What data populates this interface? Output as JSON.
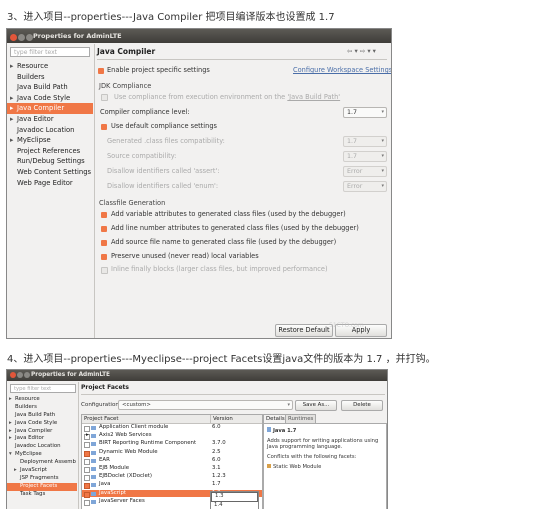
{
  "step3": {
    "text": "3、进入项目--properties---Java Compiler 把项目编译版本也设置成 1.7"
  },
  "step4": {
    "text": "4、进入项目--properties---Myeclipse---project Facets设置java文件的版本为 1.7 ，并打钩。"
  },
  "dialog1": {
    "title": "Properties for AdminLTE",
    "filter_placeholder": "type filter text",
    "tree": [
      {
        "label": "Resource",
        "arrow": "▸",
        "selected": false
      },
      {
        "label": "Builders",
        "arrow": "",
        "selected": false
      },
      {
        "label": "Java Build Path",
        "arrow": "",
        "selected": false
      },
      {
        "label": "Java Code Style",
        "arrow": "▸",
        "selected": false
      },
      {
        "label": "Java Compiler",
        "arrow": "▸",
        "selected": true
      },
      {
        "label": "Java Editor",
        "arrow": "▸",
        "selected": false
      },
      {
        "label": "Javadoc Location",
        "arrow": "",
        "selected": false
      },
      {
        "label": "MyEclipse",
        "arrow": "▸",
        "selected": false
      },
      {
        "label": "Project References",
        "arrow": "",
        "selected": false
      },
      {
        "label": "Run/Debug Settings",
        "arrow": "",
        "selected": false
      },
      {
        "label": "Web Content Settings",
        "arrow": "",
        "selected": false
      },
      {
        "label": "Web Page Editor",
        "arrow": "",
        "selected": false
      }
    ],
    "panel_title": "Java Compiler",
    "nav": "⇦ ▾ ⇨ ▾ ▾",
    "enable_specific": "Enable project specific settings",
    "configure_workspace": "Configure Workspace Settings...",
    "jdk_section": "JDK Compliance",
    "use_compliance_prefix": "Use compliance from execution environment on the ",
    "use_compliance_link": "'Java Build Path'",
    "compliance_level_label": "Compiler compliance level:",
    "compliance_level_value": "1.7",
    "use_default": "Use default compliance settings",
    "generated_label": "Generated .class files compatibility:",
    "generated_value": "1.7",
    "source_label": "Source compatibility:",
    "source_value": "1.7",
    "assert_label": "Disallow identifiers called 'assert':",
    "assert_value": "Error",
    "enum_label": "Disallow identifiers called 'enum':",
    "enum_value": "Error",
    "classfile_section": "Classfile Generation",
    "opt_variable": "Add variable attributes to generated class files (used by the debugger)",
    "opt_line": "Add line number attributes to generated class files (used by the debugger)",
    "opt_source": "Add source file name to generated class file (used by the debugger)",
    "opt_preserve": "Preserve unused (never read) local variables",
    "opt_inline": "Inline finally blocks (larger class files, but improved performance)",
    "restore_default": "Restore Default",
    "apply": "Apply",
    "watermark": "51CTO.com"
  },
  "dialog2": {
    "title": "Properties for AdminLTE",
    "filter_placeholder": "type filter text",
    "tree": [
      {
        "label": "Resource",
        "arrow": "▸",
        "indent": 0,
        "selected": false
      },
      {
        "label": "Builders",
        "arrow": "",
        "indent": 0,
        "selected": false
      },
      {
        "label": "Java Build Path",
        "arrow": "",
        "indent": 0,
        "selected": false
      },
      {
        "label": "Java Code Style",
        "arrow": "▸",
        "indent": 0,
        "selected": false
      },
      {
        "label": "Java Compiler",
        "arrow": "▸",
        "indent": 0,
        "selected": false
      },
      {
        "label": "Java Editor",
        "arrow": "▸",
        "indent": 0,
        "selected": false
      },
      {
        "label": "Javadoc Location",
        "arrow": "",
        "indent": 0,
        "selected": false
      },
      {
        "label": "MyEclipse",
        "arrow": "▾",
        "indent": 0,
        "selected": false
      },
      {
        "label": "Deployment Assemb",
        "arrow": "",
        "indent": 1,
        "selected": false
      },
      {
        "label": "JavaScript",
        "arrow": "▸",
        "indent": 1,
        "selected": false
      },
      {
        "label": "JSP Fragments",
        "arrow": "",
        "indent": 1,
        "selected": false
      },
      {
        "label": "Project Facets",
        "arrow": "",
        "indent": 1,
        "selected": true
      },
      {
        "label": "Task Tags",
        "arrow": "",
        "indent": 1,
        "selected": false
      }
    ],
    "panel_title": "Project Facets",
    "configuration_label": "Configuration:",
    "configuration_value": "<custom>",
    "save_as": "Save As...",
    "delete": "Delete",
    "col_facet": "Project Facet",
    "col_version": "Version",
    "facets": [
      {
        "name": "Application Client module",
        "version": "6.0",
        "checked": false,
        "expand": "",
        "highlight": false
      },
      {
        "name": "Axis2 Web Services",
        "version": "",
        "checked": false,
        "expand": "▸",
        "highlight": false
      },
      {
        "name": "BIRT Reporting Runtime Component",
        "version": "3.7.0",
        "checked": false,
        "expand": "",
        "highlight": false
      },
      {
        "name": "Dynamic Web Module",
        "version": "2.5",
        "checked": true,
        "expand": "",
        "highlight": false
      },
      {
        "name": "EAR",
        "version": "6.0",
        "checked": false,
        "expand": "",
        "highlight": false
      },
      {
        "name": "EJB Module",
        "version": "3.1",
        "checked": false,
        "expand": "",
        "highlight": false
      },
      {
        "name": "EJBDoclet (XDoclet)",
        "version": "1.2.3",
        "checked": false,
        "expand": "",
        "highlight": false
      },
      {
        "name": "Java",
        "version": "1.7",
        "checked": true,
        "expand": "",
        "highlight": false
      },
      {
        "name": "JavaScript",
        "version": "1.3",
        "checked": true,
        "expand": "",
        "highlight": true
      },
      {
        "name": "JavaServer Faces",
        "version": "1.4",
        "checked": false,
        "expand": "",
        "highlight": false
      }
    ],
    "version_dropdown": [
      "1.3",
      "1.4"
    ],
    "tab_details": "Details",
    "tab_runtimes": "Runtimes",
    "details_title": "Java 1.7",
    "details_desc": "Adds support for writing applications using Java programming language.",
    "conflicts_label": "Conflicts with the following facets:",
    "conflict_item": "Static Web Module"
  }
}
